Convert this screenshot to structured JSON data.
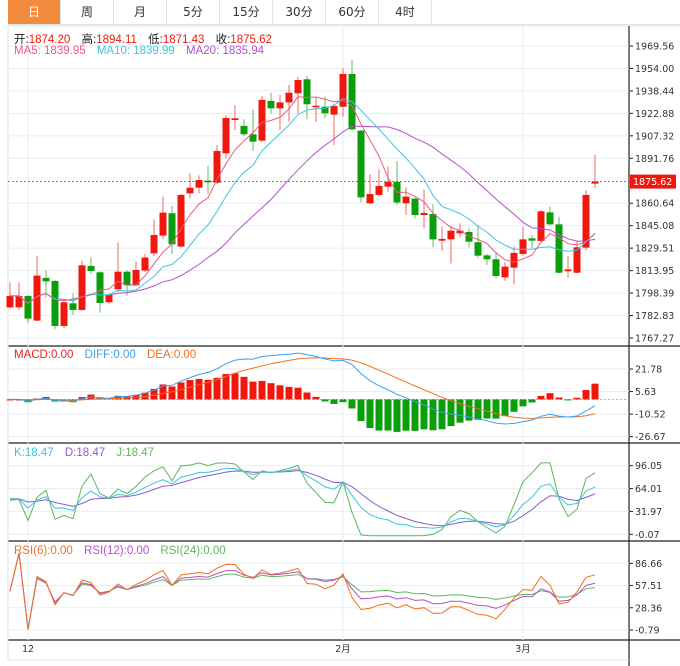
{
  "tabs": [
    {
      "label": "日",
      "active": true
    },
    {
      "label": "周"
    },
    {
      "label": "月"
    },
    {
      "label": "5分"
    },
    {
      "label": "15分"
    },
    {
      "label": "30分"
    },
    {
      "label": "60分"
    },
    {
      "label": "4时"
    }
  ],
  "ohlc_legend": {
    "open_label": "开:",
    "open": "1874.20",
    "high_label": "高:",
    "high": "1894.11",
    "low_label": "低:",
    "low": "1871.43",
    "close_label": "收:",
    "close": "1875.62"
  },
  "ma_legend": {
    "ma5": "MA5: 1839.95",
    "ma10": "MA10: 1839.99",
    "ma20": "MA20: 1835.94"
  },
  "macd_legend": {
    "macd": "MACD:0.00",
    "diff": "DIFF:0.00",
    "dea": "DEA:0.00"
  },
  "kdj_legend": {
    "k": "K:18.47",
    "d": "D:18.47",
    "j": "J:18.47"
  },
  "rsi_legend": {
    "rsi6": "RSI(6):0.00",
    "rsi12": "RSI(12):0.00",
    "rsi24": "RSI(24):0.00"
  },
  "colors": {
    "up": "#f0170c",
    "down": "#0b9e0b",
    "ma5": "#ea5b84",
    "ma10": "#3cc6dc",
    "ma20": "#b450cc",
    "diff": "#3ca0f0",
    "dea": "#f07020",
    "k": "#3cc6dc",
    "d": "#8a5cd0",
    "j": "#5cb85c",
    "rsi6": "#f07020",
    "rsi12": "#b450cc",
    "rsi24": "#5cb85c",
    "active_tab": "#f28b3b"
  },
  "chart_data": {
    "type": "candlestick",
    "price_axis": [
      "1969.56",
      "1954.00",
      "1938.44",
      "1922.88",
      "1907.32",
      "1891.76",
      "1860.64",
      "1845.08",
      "1829.51",
      "1813.95",
      "1798.39",
      "1782.83",
      "1767.27"
    ],
    "price_range": [
      1767.27,
      1969.56
    ],
    "current_price": "1875.62",
    "macd_axis": [
      "21.78",
      "5.63",
      "-10.52",
      "-26.67"
    ],
    "kdj_axis": [
      "96.05",
      "64.01",
      "31.97",
      "-0.07"
    ],
    "rsi_axis": [
      "86.66",
      "57.51",
      "28.36",
      "-0.79"
    ],
    "x_labels": [
      {
        "label": "12",
        "index": 2
      },
      {
        "label": "2月",
        "index": 37
      },
      {
        "label": "3月",
        "index": 57
      }
    ],
    "candles_ohlc": [
      [
        1788.5,
        1805.9,
        1788,
        1796.4
      ],
      [
        1788.5,
        1805.9,
        1787,
        1796.4
      ],
      [
        1796.4,
        1797,
        1777.5,
        1780.7
      ],
      [
        1779.3,
        1824.1,
        1779,
        1810.5
      ],
      [
        1808.9,
        1814,
        1795.5,
        1806.5
      ],
      [
        1806.8,
        1807.5,
        1773.3,
        1775.6
      ],
      [
        1775.6,
        1794,
        1774,
        1792
      ],
      [
        1791.3,
        1798.2,
        1783.2,
        1786.7
      ],
      [
        1786.7,
        1820.8,
        1786,
        1817.6
      ],
      [
        1817.2,
        1823.2,
        1811.6,
        1813.7
      ],
      [
        1812.8,
        1813.5,
        1784.8,
        1791.5
      ],
      [
        1792,
        1798,
        1791,
        1797
      ],
      [
        1801,
        1833.3,
        1799,
        1813.2
      ],
      [
        1813.2,
        1814,
        1796.6,
        1803.8
      ],
      [
        1803.8,
        1820.2,
        1803,
        1814.4
      ],
      [
        1814,
        1825.5,
        1813,
        1823
      ],
      [
        1825.9,
        1849.5,
        1824,
        1838.6
      ],
      [
        1838.2,
        1865.2,
        1836,
        1854.1
      ],
      [
        1853.7,
        1858.7,
        1825.5,
        1832.2
      ],
      [
        1830.6,
        1867,
        1830,
        1866.4
      ],
      [
        1867.5,
        1881.4,
        1864,
        1871.4
      ],
      [
        1871.4,
        1880,
        1867.5,
        1876.7
      ],
      [
        1876.3,
        1886.4,
        1867,
        1875.1
      ],
      [
        1874.9,
        1901,
        1874,
        1896.8
      ],
      [
        1895.2,
        1921.5,
        1892,
        1919.7
      ],
      [
        1918.3,
        1928.7,
        1911.4,
        1919.5
      ],
      [
        1914.2,
        1918.8,
        1907,
        1908.4
      ],
      [
        1908.4,
        1925.7,
        1896.8,
        1903.3
      ],
      [
        1904,
        1934.9,
        1903,
        1932.2
      ],
      [
        1931.5,
        1937.2,
        1922.9,
        1926.4
      ],
      [
        1926.4,
        1935.6,
        1911.4,
        1930.5
      ],
      [
        1930.5,
        1942.5,
        1917,
        1937.2
      ],
      [
        1936.8,
        1948.3,
        1923,
        1946
      ],
      [
        1946.5,
        1949,
        1918.8,
        1929.2
      ],
      [
        1927.1,
        1934.5,
        1917,
        1928.2
      ],
      [
        1927.5,
        1934.5,
        1919.5,
        1922.9
      ],
      [
        1922,
        1929,
        1901,
        1928
      ],
      [
        1927.5,
        1954.1,
        1920.6,
        1950.2
      ],
      [
        1950.2,
        1959.9,
        1911,
        1911.8
      ],
      [
        1910.9,
        1911.5,
        1861.3,
        1864.7
      ],
      [
        1860.6,
        1880.9,
        1860,
        1867
      ],
      [
        1866.4,
        1884.1,
        1865.2,
        1872.6
      ],
      [
        1872.1,
        1886,
        1868.7,
        1875.4
      ],
      [
        1875.4,
        1889.9,
        1859.4,
        1861.1
      ],
      [
        1860.6,
        1871.7,
        1852.5,
        1865.2
      ],
      [
        1863.8,
        1864.5,
        1850.2,
        1852.5
      ],
      [
        1852.5,
        1870.3,
        1843.3,
        1853.9
      ],
      [
        1853.2,
        1860.1,
        1830.1,
        1835.6
      ],
      [
        1834.7,
        1844.4,
        1827.6,
        1835.9
      ],
      [
        1835.6,
        1844.9,
        1819,
        1841.6
      ],
      [
        1839.8,
        1846.7,
        1837,
        1841.6
      ],
      [
        1840.7,
        1843.3,
        1830.1,
        1834
      ],
      [
        1833.6,
        1845.6,
        1822.5,
        1824.3
      ],
      [
        1824.5,
        1825.5,
        1817.9,
        1821.8
      ],
      [
        1821.8,
        1826.4,
        1808.6,
        1810.2
      ],
      [
        1809.3,
        1819.9,
        1806.8,
        1816.7
      ],
      [
        1816,
        1830.5,
        1804.5,
        1826.2
      ],
      [
        1825.5,
        1844.4,
        1824.5,
        1835.6
      ],
      [
        1836.3,
        1838.6,
        1829.4,
        1834.7
      ],
      [
        1834.5,
        1856,
        1834,
        1855
      ],
      [
        1854.3,
        1858.3,
        1845.1,
        1846
      ],
      [
        1846,
        1851.3,
        1812,
        1812.5
      ],
      [
        1813.5,
        1824.1,
        1808.9,
        1814.8
      ],
      [
        1812.5,
        1834.2,
        1812,
        1830.1
      ],
      [
        1829.9,
        1869.8,
        1827.8,
        1866.4
      ],
      [
        1874.2,
        1894.11,
        1871.43,
        1875.62
      ]
    ]
  }
}
